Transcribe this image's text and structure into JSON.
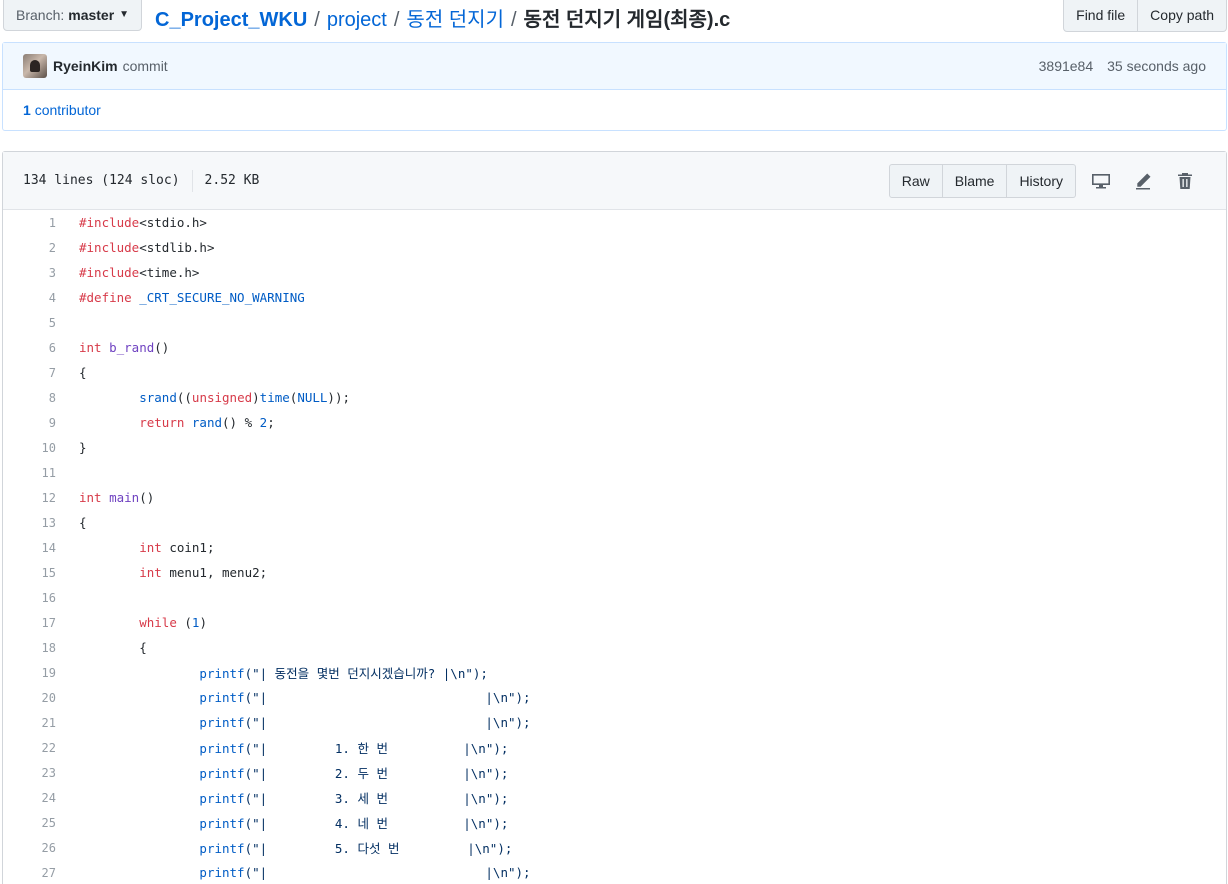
{
  "branch": {
    "label": "Branch:",
    "value": "master"
  },
  "breadcrumb": {
    "root": "C_Project_WKU",
    "parts": [
      "project",
      "동전 던지기"
    ],
    "file": "동전 던지기 게임(최종).c",
    "separator": "/"
  },
  "header_buttons": {
    "find_file": "Find file",
    "copy_path": "Copy path"
  },
  "commit": {
    "author": "RyeinKim",
    "message": "commit",
    "sha": "3891e84",
    "age": "35 seconds ago",
    "contributors_count": "1",
    "contributors_label": "contributor"
  },
  "file": {
    "lines": "134 lines (124 sloc)",
    "size": "2.52 KB",
    "raw": "Raw",
    "blame": "Blame",
    "history": "History"
  },
  "icons": [
    "desktop-icon",
    "pencil-icon",
    "trash-icon",
    "chevron-down-icon"
  ],
  "code_lines": [
    [
      [
        "k",
        "#include"
      ],
      [
        "",
        "<stdio.h>"
      ]
    ],
    [
      [
        "k",
        "#include"
      ],
      [
        "",
        "<stdlib.h>"
      ]
    ],
    [
      [
        "k",
        "#include"
      ],
      [
        "",
        "<time.h>"
      ]
    ],
    [
      [
        "k",
        "#define"
      ],
      [
        "",
        " "
      ],
      [
        "c",
        "_CRT_SECURE_NO_WARNING"
      ]
    ],
    [],
    [
      [
        "k",
        "int"
      ],
      [
        "",
        " "
      ],
      [
        "f",
        "b_rand"
      ],
      [
        "",
        "()"
      ]
    ],
    [
      [
        "",
        "{"
      ]
    ],
    [
      [
        "",
        "        "
      ],
      [
        "c",
        "srand"
      ],
      [
        "",
        "(("
      ],
      [
        "k",
        "unsigned"
      ],
      [
        "",
        ")"
      ],
      [
        "c",
        "time"
      ],
      [
        "",
        "("
      ],
      [
        "c",
        "NULL"
      ],
      [
        "",
        "));"
      ]
    ],
    [
      [
        "",
        "        "
      ],
      [
        "k",
        "return"
      ],
      [
        "",
        " "
      ],
      [
        "c",
        "rand"
      ],
      [
        "",
        "() % "
      ],
      [
        "c",
        "2"
      ],
      [
        "",
        ";"
      ]
    ],
    [
      [
        "",
        "}"
      ]
    ],
    [],
    [
      [
        "k",
        "int"
      ],
      [
        "",
        " "
      ],
      [
        "f",
        "main"
      ],
      [
        "",
        "()"
      ]
    ],
    [
      [
        "",
        "{"
      ]
    ],
    [
      [
        "",
        "        "
      ],
      [
        "k",
        "int"
      ],
      [
        "",
        " coin1;"
      ]
    ],
    [
      [
        "",
        "        "
      ],
      [
        "k",
        "int"
      ],
      [
        "",
        " menu1, menu2;"
      ]
    ],
    [],
    [
      [
        "",
        "        "
      ],
      [
        "k",
        "while"
      ],
      [
        "",
        " ("
      ],
      [
        "c",
        "1"
      ],
      [
        "",
        ")"
      ]
    ],
    [
      [
        "",
        "        {"
      ]
    ],
    [
      [
        "",
        "                "
      ],
      [
        "c",
        "printf"
      ],
      [
        "s",
        "(\"| 동전을 몇번 던지시겠습니까? |\\n\");"
      ]
    ],
    [
      [
        "",
        "                "
      ],
      [
        "c",
        "printf"
      ],
      [
        "s",
        "(\"|                             |\\n\");"
      ]
    ],
    [
      [
        "",
        "                "
      ],
      [
        "c",
        "printf"
      ],
      [
        "s",
        "(\"|                             |\\n\");"
      ]
    ],
    [
      [
        "",
        "                "
      ],
      [
        "c",
        "printf"
      ],
      [
        "s",
        "(\"|         1. 한 번          |\\n\");"
      ]
    ],
    [
      [
        "",
        "                "
      ],
      [
        "c",
        "printf"
      ],
      [
        "s",
        "(\"|         2. 두 번          |\\n\");"
      ]
    ],
    [
      [
        "",
        "                "
      ],
      [
        "c",
        "printf"
      ],
      [
        "s",
        "(\"|         3. 세 번          |\\n\");"
      ]
    ],
    [
      [
        "",
        "                "
      ],
      [
        "c",
        "printf"
      ],
      [
        "s",
        "(\"|         4. 네 번          |\\n\");"
      ]
    ],
    [
      [
        "",
        "                "
      ],
      [
        "c",
        "printf"
      ],
      [
        "s",
        "(\"|         5. 다섯 번         |\\n\");"
      ]
    ],
    [
      [
        "",
        "                "
      ],
      [
        "c",
        "printf"
      ],
      [
        "s",
        "(\"|                             |\\n\");"
      ]
    ]
  ]
}
